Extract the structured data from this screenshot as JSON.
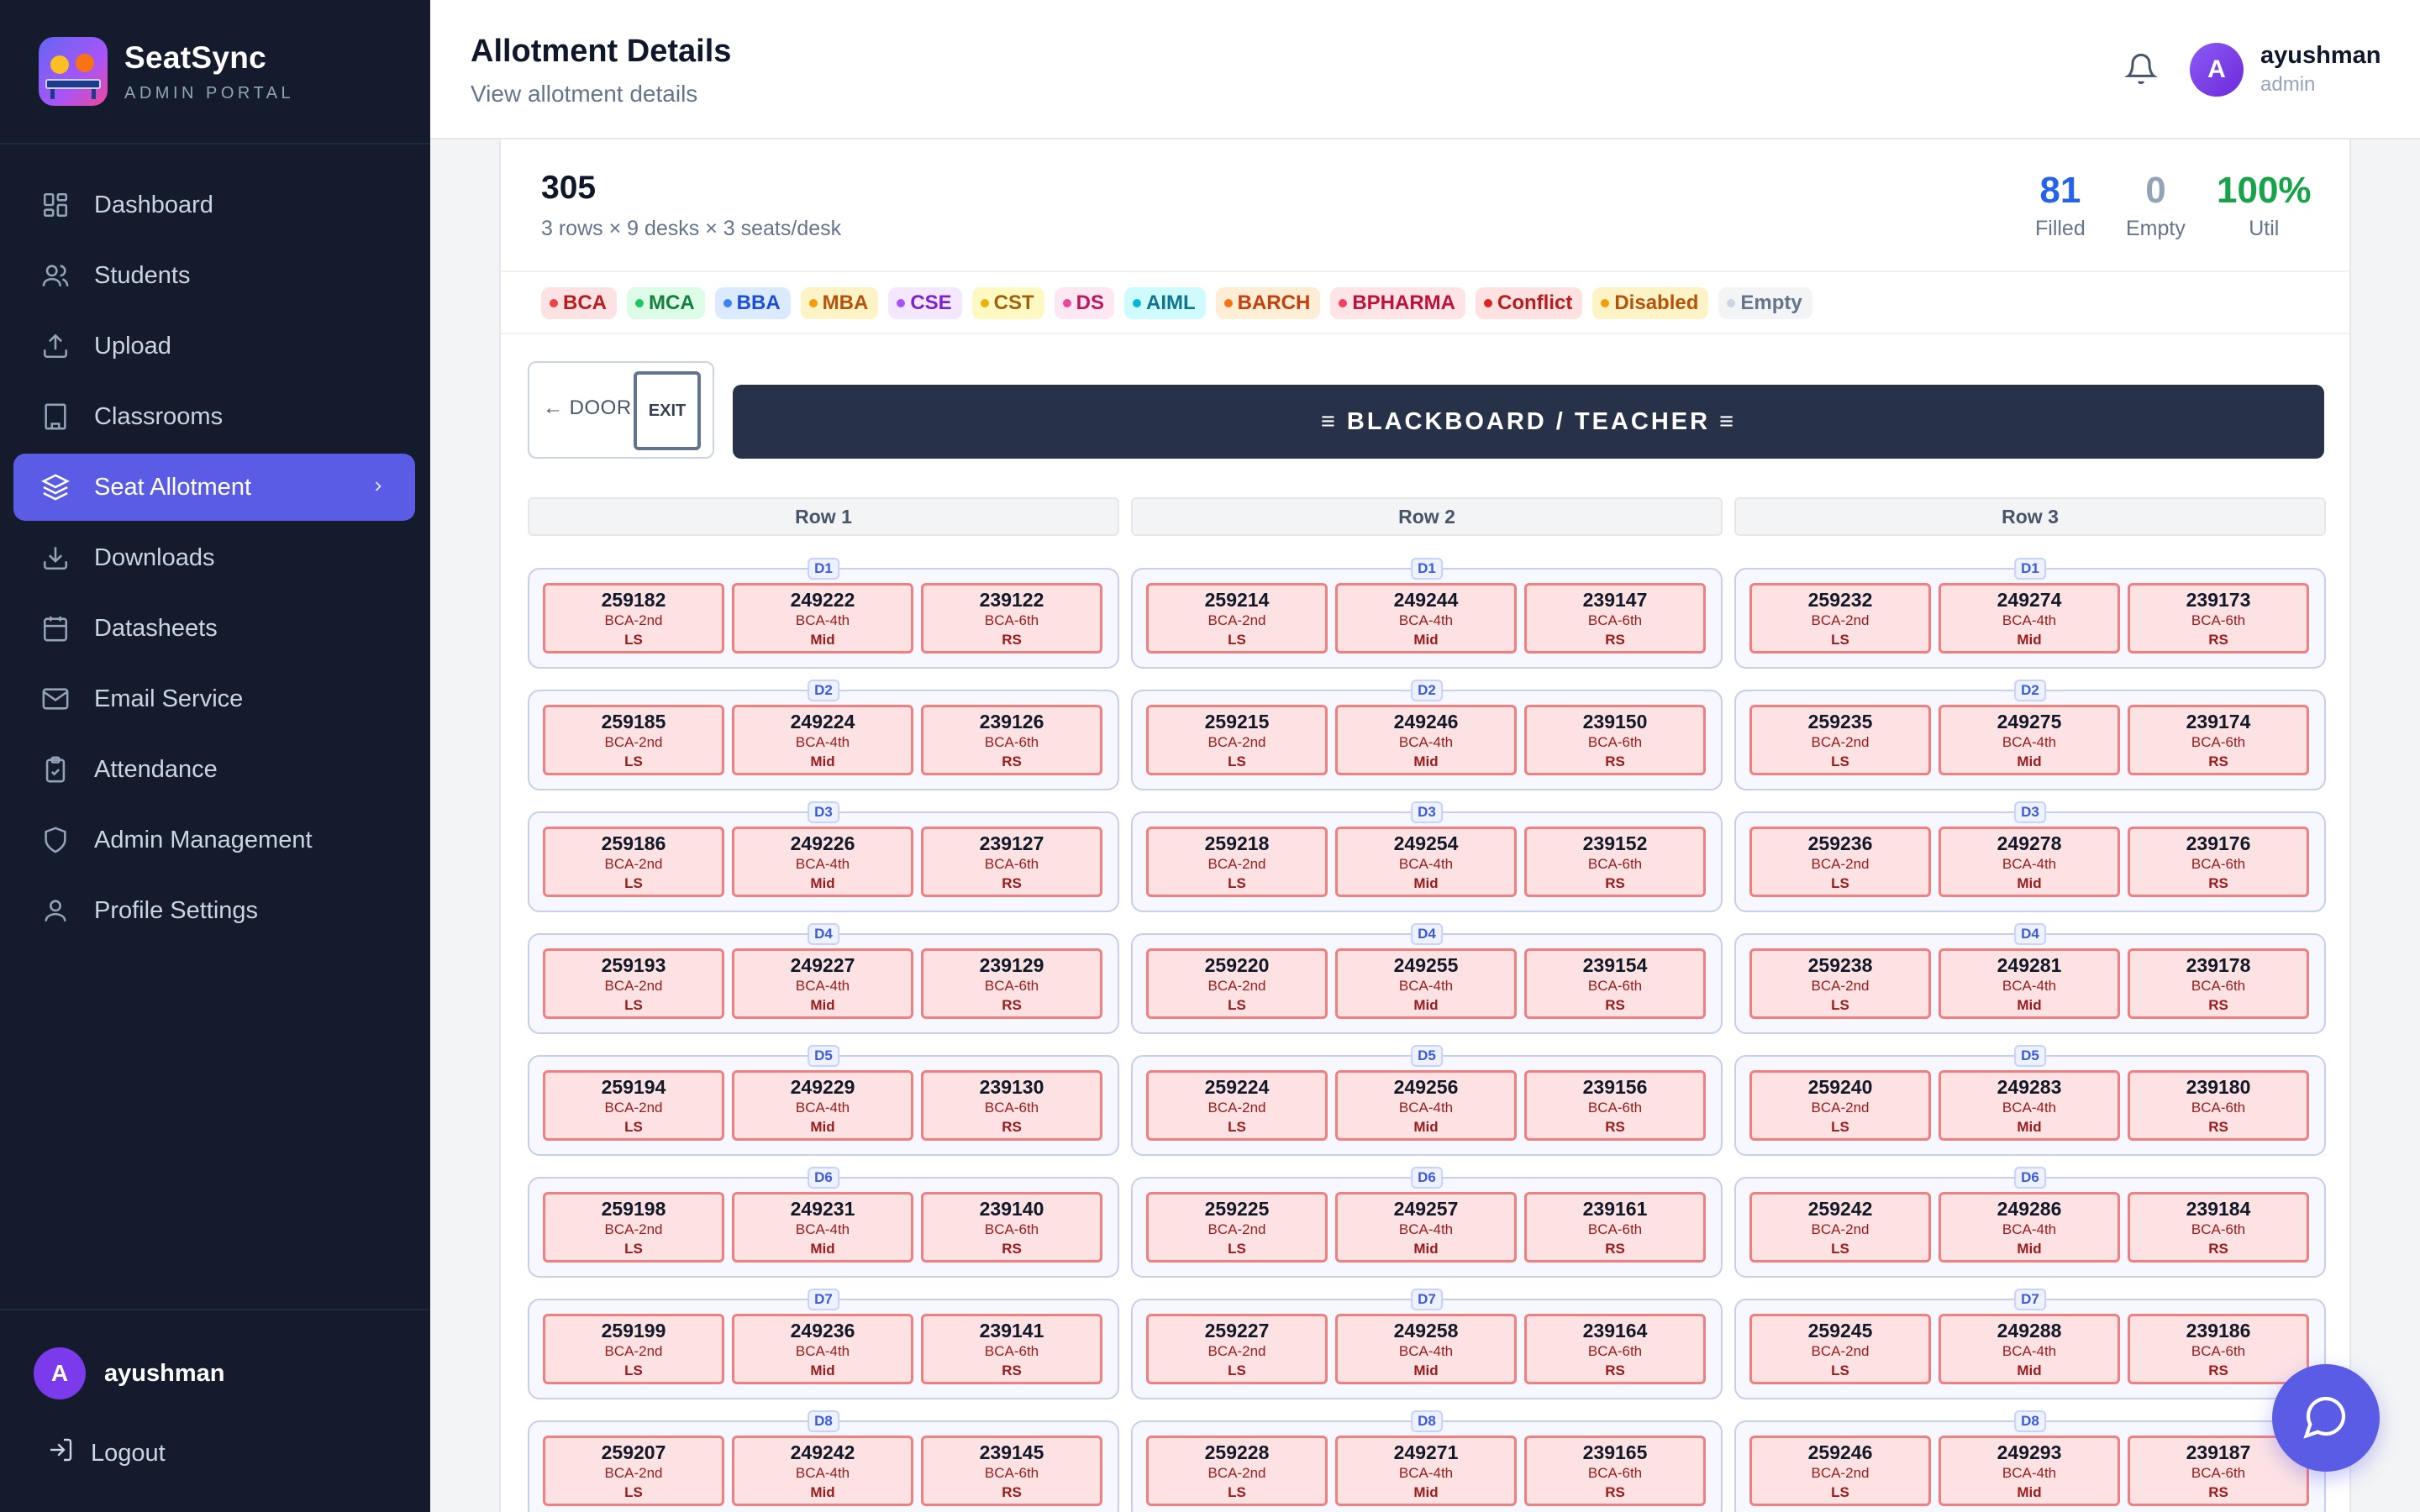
{
  "brand": {
    "name": "SeatSync",
    "subtitle": "ADMIN PORTAL"
  },
  "sidebar": {
    "items": [
      {
        "label": "Dashboard",
        "icon": "dashboard-icon"
      },
      {
        "label": "Students",
        "icon": "users-icon"
      },
      {
        "label": "Upload",
        "icon": "upload-icon"
      },
      {
        "label": "Classrooms",
        "icon": "building-icon"
      },
      {
        "label": "Seat Allotment",
        "icon": "layers-icon",
        "active": true
      },
      {
        "label": "Downloads",
        "icon": "download-icon"
      },
      {
        "label": "Datasheets",
        "icon": "calendar-icon"
      },
      {
        "label": "Email Service",
        "icon": "mail-icon"
      },
      {
        "label": "Attendance",
        "icon": "clipboard-icon"
      },
      {
        "label": "Admin Management",
        "icon": "shield-icon"
      },
      {
        "label": "Profile Settings",
        "icon": "user-icon"
      }
    ],
    "user": {
      "initial": "A",
      "name": "ayushman"
    },
    "logout_label": "Logout"
  },
  "header": {
    "title": "Allotment Details",
    "subtitle": "View allotment details",
    "user": {
      "initial": "A",
      "name": "ayushman",
      "role": "admin"
    }
  },
  "room": {
    "number": "305",
    "description": "3 rows × 9 desks × 3 seats/desk",
    "stats": {
      "filled": {
        "value": "81",
        "label": "Filled",
        "color": "#2563eb"
      },
      "empty": {
        "value": "0",
        "label": "Empty",
        "color": "#94a3b8"
      },
      "util": {
        "value": "100%",
        "label": "Util",
        "color": "#16a34a"
      }
    }
  },
  "legend": [
    {
      "label": "BCA",
      "bg": "#fde2e4",
      "dot": "#ef4444",
      "fg": "#b91c1c"
    },
    {
      "label": "MCA",
      "bg": "#dcfce7",
      "dot": "#22c55e",
      "fg": "#15803d"
    },
    {
      "label": "BBA",
      "bg": "#dbeafe",
      "dot": "#3b82f6",
      "fg": "#1d4ed8"
    },
    {
      "label": "MBA",
      "bg": "#fef3c7",
      "dot": "#f59e0b",
      "fg": "#b45309"
    },
    {
      "label": "CSE",
      "bg": "#f3e8ff",
      "dot": "#a855f7",
      "fg": "#7e22ce"
    },
    {
      "label": "CST",
      "bg": "#fef9c3",
      "dot": "#eab308",
      "fg": "#a16207"
    },
    {
      "label": "DS",
      "bg": "#fce7f3",
      "dot": "#ec4899",
      "fg": "#be185d"
    },
    {
      "label": "AIML",
      "bg": "#cffafe",
      "dot": "#06b6d4",
      "fg": "#0e7490"
    },
    {
      "label": "BARCH",
      "bg": "#ffedd5",
      "dot": "#f97316",
      "fg": "#c2410c"
    },
    {
      "label": "BPHARMA",
      "bg": "#ffe4e6",
      "dot": "#f43f5e",
      "fg": "#be123c"
    },
    {
      "label": "Conflict",
      "bg": "#fee2e2",
      "dot": "#dc2626",
      "fg": "#b91c1c"
    },
    {
      "label": "Disabled",
      "bg": "#fef3c7",
      "dot": "#f59e0b",
      "fg": "#b45309"
    },
    {
      "label": "Empty",
      "bg": "#f3f4f6",
      "dot": "#cbd5e1",
      "fg": "#64748b"
    }
  ],
  "layout_labels": {
    "door": "← DOOR",
    "exit": "EXIT",
    "board": "≡ BLACKBOARD / TEACHER ≡"
  },
  "grid": {
    "rows": [
      {
        "label": "Row 1",
        "desks": [
          {
            "label": "D1",
            "seats": [
              {
                "id": "259182",
                "cls": "BCA-2nd",
                "pos": "LS"
              },
              {
                "id": "249222",
                "cls": "BCA-4th",
                "pos": "Mid"
              },
              {
                "id": "239122",
                "cls": "BCA-6th",
                "pos": "RS"
              }
            ]
          },
          {
            "label": "D2",
            "seats": [
              {
                "id": "259185",
                "cls": "BCA-2nd",
                "pos": "LS"
              },
              {
                "id": "249224",
                "cls": "BCA-4th",
                "pos": "Mid"
              },
              {
                "id": "239126",
                "cls": "BCA-6th",
                "pos": "RS"
              }
            ]
          },
          {
            "label": "D3",
            "seats": [
              {
                "id": "259186",
                "cls": "BCA-2nd",
                "pos": "LS"
              },
              {
                "id": "249226",
                "cls": "BCA-4th",
                "pos": "Mid"
              },
              {
                "id": "239127",
                "cls": "BCA-6th",
                "pos": "RS"
              }
            ]
          },
          {
            "label": "D4",
            "seats": [
              {
                "id": "259193",
                "cls": "BCA-2nd",
                "pos": "LS"
              },
              {
                "id": "249227",
                "cls": "BCA-4th",
                "pos": "Mid"
              },
              {
                "id": "239129",
                "cls": "BCA-6th",
                "pos": "RS"
              }
            ]
          },
          {
            "label": "D5",
            "seats": [
              {
                "id": "259194",
                "cls": "BCA-2nd",
                "pos": "LS"
              },
              {
                "id": "249229",
                "cls": "BCA-4th",
                "pos": "Mid"
              },
              {
                "id": "239130",
                "cls": "BCA-6th",
                "pos": "RS"
              }
            ]
          },
          {
            "label": "D6",
            "seats": [
              {
                "id": "259198",
                "cls": "BCA-2nd",
                "pos": "LS"
              },
              {
                "id": "249231",
                "cls": "BCA-4th",
                "pos": "Mid"
              },
              {
                "id": "239140",
                "cls": "BCA-6th",
                "pos": "RS"
              }
            ]
          },
          {
            "label": "D7",
            "seats": [
              {
                "id": "259199",
                "cls": "BCA-2nd",
                "pos": "LS"
              },
              {
                "id": "249236",
                "cls": "BCA-4th",
                "pos": "Mid"
              },
              {
                "id": "239141",
                "cls": "BCA-6th",
                "pos": "RS"
              }
            ]
          },
          {
            "label": "D8",
            "seats": [
              {
                "id": "259207",
                "cls": "BCA-2nd",
                "pos": "LS"
              },
              {
                "id": "249242",
                "cls": "BCA-4th",
                "pos": "Mid"
              },
              {
                "id": "239145",
                "cls": "BCA-6th",
                "pos": "RS"
              }
            ]
          }
        ]
      },
      {
        "label": "Row 2",
        "desks": [
          {
            "label": "D1",
            "seats": [
              {
                "id": "259214",
                "cls": "BCA-2nd",
                "pos": "LS"
              },
              {
                "id": "249244",
                "cls": "BCA-4th",
                "pos": "Mid"
              },
              {
                "id": "239147",
                "cls": "BCA-6th",
                "pos": "RS"
              }
            ]
          },
          {
            "label": "D2",
            "seats": [
              {
                "id": "259215",
                "cls": "BCA-2nd",
                "pos": "LS"
              },
              {
                "id": "249246",
                "cls": "BCA-4th",
                "pos": "Mid"
              },
              {
                "id": "239150",
                "cls": "BCA-6th",
                "pos": "RS"
              }
            ]
          },
          {
            "label": "D3",
            "seats": [
              {
                "id": "259218",
                "cls": "BCA-2nd",
                "pos": "LS"
              },
              {
                "id": "249254",
                "cls": "BCA-4th",
                "pos": "Mid"
              },
              {
                "id": "239152",
                "cls": "BCA-6th",
                "pos": "RS"
              }
            ]
          },
          {
            "label": "D4",
            "seats": [
              {
                "id": "259220",
                "cls": "BCA-2nd",
                "pos": "LS"
              },
              {
                "id": "249255",
                "cls": "BCA-4th",
                "pos": "Mid"
              },
              {
                "id": "239154",
                "cls": "BCA-6th",
                "pos": "RS"
              }
            ]
          },
          {
            "label": "D5",
            "seats": [
              {
                "id": "259224",
                "cls": "BCA-2nd",
                "pos": "LS"
              },
              {
                "id": "249256",
                "cls": "BCA-4th",
                "pos": "Mid"
              },
              {
                "id": "239156",
                "cls": "BCA-6th",
                "pos": "RS"
              }
            ]
          },
          {
            "label": "D6",
            "seats": [
              {
                "id": "259225",
                "cls": "BCA-2nd",
                "pos": "LS"
              },
              {
                "id": "249257",
                "cls": "BCA-4th",
                "pos": "Mid"
              },
              {
                "id": "239161",
                "cls": "BCA-6th",
                "pos": "RS"
              }
            ]
          },
          {
            "label": "D7",
            "seats": [
              {
                "id": "259227",
                "cls": "BCA-2nd",
                "pos": "LS"
              },
              {
                "id": "249258",
                "cls": "BCA-4th",
                "pos": "Mid"
              },
              {
                "id": "239164",
                "cls": "BCA-6th",
                "pos": "RS"
              }
            ]
          },
          {
            "label": "D8",
            "seats": [
              {
                "id": "259228",
                "cls": "BCA-2nd",
                "pos": "LS"
              },
              {
                "id": "249271",
                "cls": "BCA-4th",
                "pos": "Mid"
              },
              {
                "id": "239165",
                "cls": "BCA-6th",
                "pos": "RS"
              }
            ]
          }
        ]
      },
      {
        "label": "Row 3",
        "desks": [
          {
            "label": "D1",
            "seats": [
              {
                "id": "259232",
                "cls": "BCA-2nd",
                "pos": "LS"
              },
              {
                "id": "249274",
                "cls": "BCA-4th",
                "pos": "Mid"
              },
              {
                "id": "239173",
                "cls": "BCA-6th",
                "pos": "RS"
              }
            ]
          },
          {
            "label": "D2",
            "seats": [
              {
                "id": "259235",
                "cls": "BCA-2nd",
                "pos": "LS"
              },
              {
                "id": "249275",
                "cls": "BCA-4th",
                "pos": "Mid"
              },
              {
                "id": "239174",
                "cls": "BCA-6th",
                "pos": "RS"
              }
            ]
          },
          {
            "label": "D3",
            "seats": [
              {
                "id": "259236",
                "cls": "BCA-2nd",
                "pos": "LS"
              },
              {
                "id": "249278",
                "cls": "BCA-4th",
                "pos": "Mid"
              },
              {
                "id": "239176",
                "cls": "BCA-6th",
                "pos": "RS"
              }
            ]
          },
          {
            "label": "D4",
            "seats": [
              {
                "id": "259238",
                "cls": "BCA-2nd",
                "pos": "LS"
              },
              {
                "id": "249281",
                "cls": "BCA-4th",
                "pos": "Mid"
              },
              {
                "id": "239178",
                "cls": "BCA-6th",
                "pos": "RS"
              }
            ]
          },
          {
            "label": "D5",
            "seats": [
              {
                "id": "259240",
                "cls": "BCA-2nd",
                "pos": "LS"
              },
              {
                "id": "249283",
                "cls": "BCA-4th",
                "pos": "Mid"
              },
              {
                "id": "239180",
                "cls": "BCA-6th",
                "pos": "RS"
              }
            ]
          },
          {
            "label": "D6",
            "seats": [
              {
                "id": "259242",
                "cls": "BCA-2nd",
                "pos": "LS"
              },
              {
                "id": "249286",
                "cls": "BCA-4th",
                "pos": "Mid"
              },
              {
                "id": "239184",
                "cls": "BCA-6th",
                "pos": "RS"
              }
            ]
          },
          {
            "label": "D7",
            "seats": [
              {
                "id": "259245",
                "cls": "BCA-2nd",
                "pos": "LS"
              },
              {
                "id": "249288",
                "cls": "BCA-4th",
                "pos": "Mid"
              },
              {
                "id": "239186",
                "cls": "BCA-6th",
                "pos": "RS"
              }
            ]
          },
          {
            "label": "D8",
            "seats": [
              {
                "id": "259246",
                "cls": "BCA-2nd",
                "pos": "LS"
              },
              {
                "id": "249293",
                "cls": "BCA-4th",
                "pos": "Mid"
              },
              {
                "id": "239187",
                "cls": "BCA-6th",
                "pos": "RS"
              }
            ]
          }
        ]
      }
    ]
  }
}
